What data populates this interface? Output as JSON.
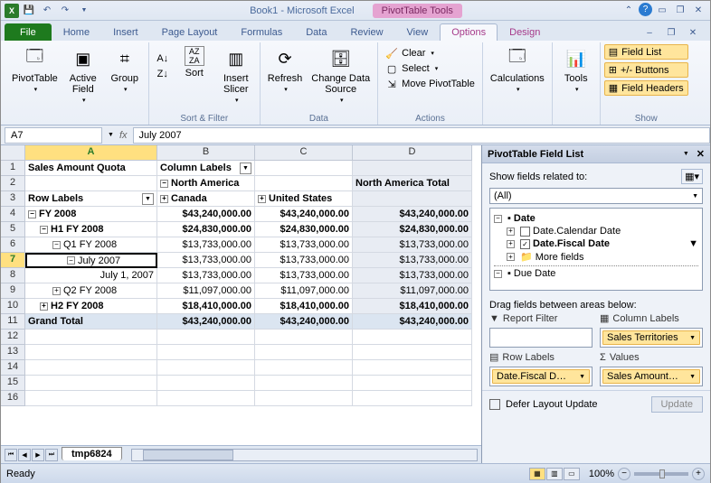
{
  "title": {
    "doc": "Book1",
    "app": "Microsoft Excel",
    "context": "PivotTable Tools"
  },
  "tabs": [
    "File",
    "Home",
    "Insert",
    "Page Layout",
    "Formulas",
    "Data",
    "Review",
    "View",
    "Options",
    "Design"
  ],
  "ribbon": {
    "pivot_table": "PivotTable",
    "active_field": "Active\nField",
    "group": "Group",
    "sort": "Sort",
    "insert_slicer": "Insert\nSlicer",
    "refresh": "Refresh",
    "change_source": "Change Data\nSource",
    "clear": "Clear",
    "select": "Select",
    "move": "Move PivotTable",
    "calculations": "Calculations",
    "tools": "Tools",
    "field_list": "Field List",
    "pm_buttons": "+/- Buttons",
    "field_headers": "Field Headers",
    "g_sort": "Sort & Filter",
    "g_data": "Data",
    "g_actions": "Actions",
    "g_show": "Show"
  },
  "name_box": "A7",
  "formula": "July 2007",
  "cols": [
    "A",
    "B",
    "C",
    "D"
  ],
  "grid": {
    "r1": {
      "a": "Sales Amount Quota",
      "b": "Column Labels"
    },
    "r2": {
      "b": "North America",
      "d": "North America Total"
    },
    "r3": {
      "a": "Row Labels",
      "b": "Canada",
      "c": "United States"
    },
    "r4": {
      "a": "FY 2008",
      "b": "$43,240,000.00",
      "c": "$43,240,000.00",
      "d": "$43,240,000.00"
    },
    "r5": {
      "a": "H1 FY 2008",
      "b": "$24,830,000.00",
      "c": "$24,830,000.00",
      "d": "$24,830,000.00"
    },
    "r6": {
      "a": "Q1 FY 2008",
      "b": "$13,733,000.00",
      "c": "$13,733,000.00",
      "d": "$13,733,000.00"
    },
    "r7": {
      "a": "July 2007",
      "b": "$13,733,000.00",
      "c": "$13,733,000.00",
      "d": "$13,733,000.00"
    },
    "r8": {
      "a": "July 1, 2007",
      "b": "$13,733,000.00",
      "c": "$13,733,000.00",
      "d": "$13,733,000.00"
    },
    "r9": {
      "a": "Q2 FY 2008",
      "b": "$11,097,000.00",
      "c": "$11,097,000.00",
      "d": "$11,097,000.00"
    },
    "r10": {
      "a": "H2 FY 2008",
      "b": "$18,410,000.00",
      "c": "$18,410,000.00",
      "d": "$18,410,000.00"
    },
    "r11": {
      "a": "Grand Total",
      "b": "$43,240,000.00",
      "c": "$43,240,000.00",
      "d": "$43,240,000.00"
    }
  },
  "taskpane": {
    "title": "PivotTable Field List",
    "show_fields": "Show fields related to:",
    "combo": "(All)",
    "tree": {
      "date": "Date",
      "calendar": "Date.Calendar Date",
      "fiscal": "Date.Fiscal Date",
      "more": "More fields",
      "due": "Due Date"
    },
    "drag_label": "Drag fields between areas below:",
    "area1": "Report Filter",
    "area2": "Column Labels",
    "area3": "Row Labels",
    "area4": "Values",
    "chip_col": "Sales Territories",
    "chip_row": "Date.Fiscal D…",
    "chip_val": "Sales Amount…",
    "defer": "Defer Layout Update",
    "update": "Update"
  },
  "sheet_tab": "tmp6824",
  "status": "Ready",
  "zoom": "100%"
}
